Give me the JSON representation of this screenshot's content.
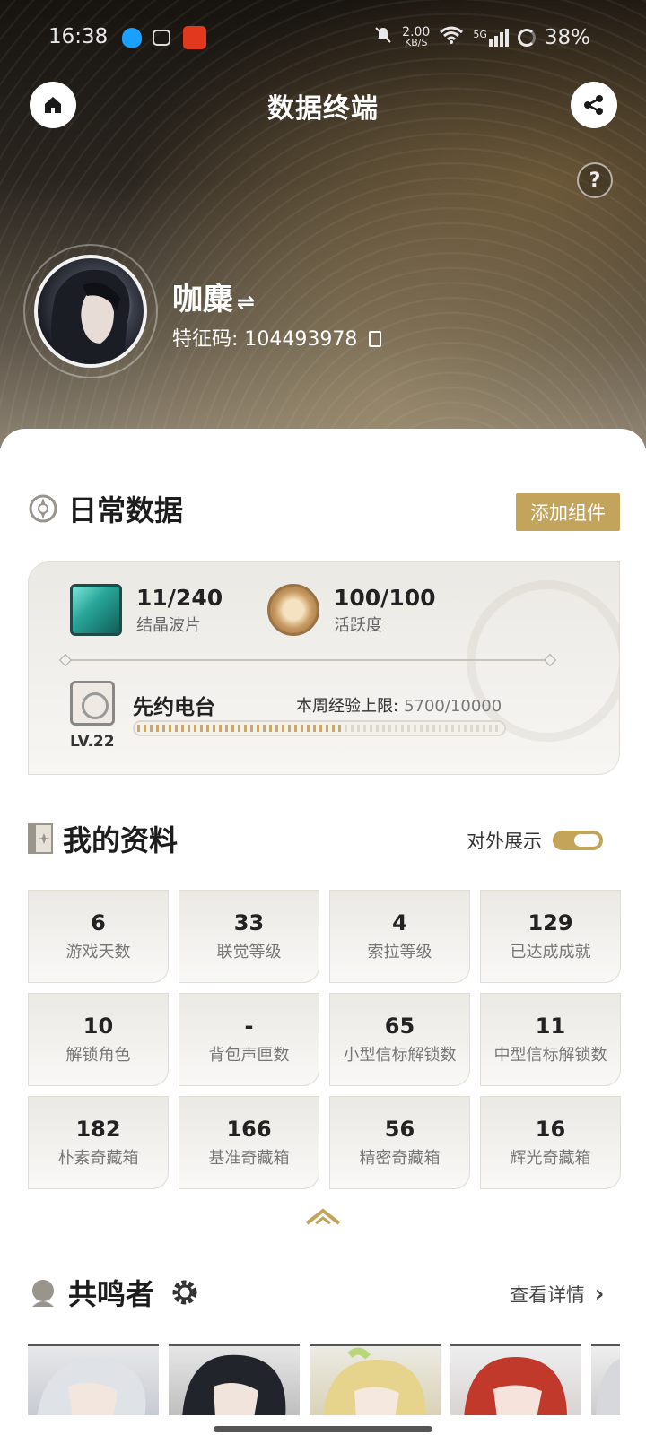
{
  "status_bar": {
    "time": "16:38",
    "speed_value": "2.00",
    "speed_unit": "KB/S",
    "network": "5G",
    "battery": "38%"
  },
  "header": {
    "title": "数据终端",
    "help": "?"
  },
  "profile": {
    "name": "咖麋",
    "switch_glyph": "⇌",
    "uid_text": "特征码: 104493978"
  },
  "daily": {
    "title": "日常数据",
    "add_widget": "添加组件",
    "waveplate_value": "11/240",
    "waveplate_label": "结晶波片",
    "activity_value": "100/100",
    "activity_label": "活跃度",
    "radio_name": "先约电台",
    "radio_level": "LV.22",
    "weekly_exp_label": "本周经验上限:",
    "weekly_exp_value": "5700/10000",
    "weekly_exp_fraction": 0.57
  },
  "my_profile": {
    "title": "我的资料",
    "public_label": "对外展示",
    "public_on": true,
    "stats": [
      {
        "value": "6",
        "label": "游戏天数"
      },
      {
        "value": "33",
        "label": "联觉等级"
      },
      {
        "value": "4",
        "label": "索拉等级"
      },
      {
        "value": "129",
        "label": "已达成成就"
      },
      {
        "value": "10",
        "label": "解锁角色"
      },
      {
        "value": "-",
        "label": "背包声匣数"
      },
      {
        "value": "65",
        "label": "小型信标解锁数"
      },
      {
        "value": "11",
        "label": "中型信标解锁数"
      },
      {
        "value": "182",
        "label": "朴素奇藏箱"
      },
      {
        "value": "166",
        "label": "基准奇藏箱"
      },
      {
        "value": "56",
        "label": "精密奇藏箱"
      },
      {
        "value": "16",
        "label": "辉光奇藏箱"
      }
    ]
  },
  "resonators": {
    "title": "共鸣者",
    "view_details": "查看详情",
    "chevron": "›"
  },
  "colors": {
    "accent_gold": "#c2a45d",
    "hero_dark": "#17130f"
  },
  "icons": [
    "home-icon",
    "share-icon",
    "help-icon",
    "copy-icon",
    "daily-data-icon",
    "crystal-cube-icon",
    "compass-icon",
    "radio-icon",
    "profile-book-icon",
    "resonator-avatar-icon",
    "settings-gear-icon",
    "collapse-arrow-icon",
    "chevron-right-icon"
  ]
}
